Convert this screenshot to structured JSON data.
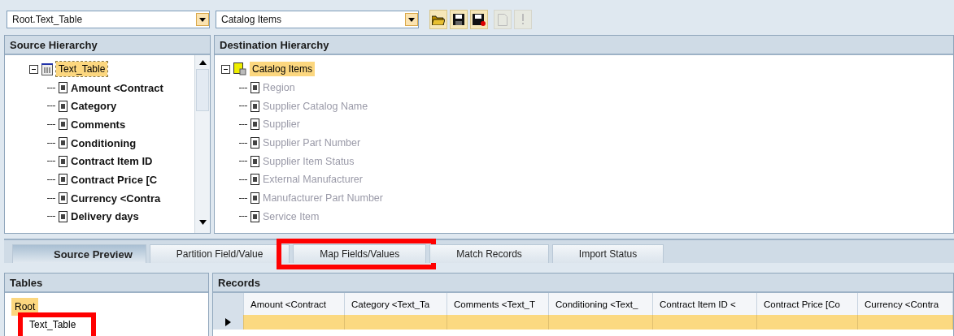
{
  "toolbar": {
    "source_combo": {
      "value": "Root.Text_Table"
    },
    "destination_combo": {
      "value": "Catalog Items"
    }
  },
  "source_hierarchy": {
    "title": "Source Hierarchy",
    "root": {
      "label": "Text_Table",
      "selected": true,
      "children": [
        {
          "label": "Amount <Contract"
        },
        {
          "label": "Category"
        },
        {
          "label": "Comments"
        },
        {
          "label": "Conditioning"
        },
        {
          "label": "Contract Item ID"
        },
        {
          "label": "Contract Price [C"
        },
        {
          "label": "Currency <Contra"
        },
        {
          "label": "Delivery days"
        }
      ]
    }
  },
  "destination_hierarchy": {
    "title": "Destination Hierarchy",
    "root": {
      "label": "Catalog Items",
      "selected": true,
      "children": [
        {
          "label": "Region"
        },
        {
          "label": "Supplier Catalog Name"
        },
        {
          "label": "Supplier"
        },
        {
          "label": "Supplier Part Number"
        },
        {
          "label": "Supplier Item Status"
        },
        {
          "label": "External Manufacturer"
        },
        {
          "label": "Manufacturer Part Number"
        },
        {
          "label": "Service Item"
        }
      ]
    }
  },
  "tabs": [
    {
      "label": "Source Preview",
      "selected": true,
      "highlighted": false
    },
    {
      "label": "Partition Field/Value",
      "selected": false,
      "highlighted": false
    },
    {
      "label": "Map Fields/Values",
      "selected": false,
      "highlighted": true
    },
    {
      "label": "Match Records",
      "selected": false,
      "highlighted": false
    },
    {
      "label": "Import Status",
      "selected": false,
      "highlighted": false
    }
  ],
  "tables": {
    "title": "Tables",
    "items": [
      {
        "label": "Root",
        "selected": true,
        "highlighted": false
      },
      {
        "label": "Text_Table",
        "selected": false,
        "highlighted": true
      }
    ]
  },
  "records": {
    "title": "Records",
    "columns": [
      "Amount <Contract",
      "Category <Text_Ta",
      "Comments <Text_T",
      "Conditioning <Text_",
      "Contract Item ID <",
      "Contract Price [Co",
      "Currency <Contra"
    ]
  }
}
